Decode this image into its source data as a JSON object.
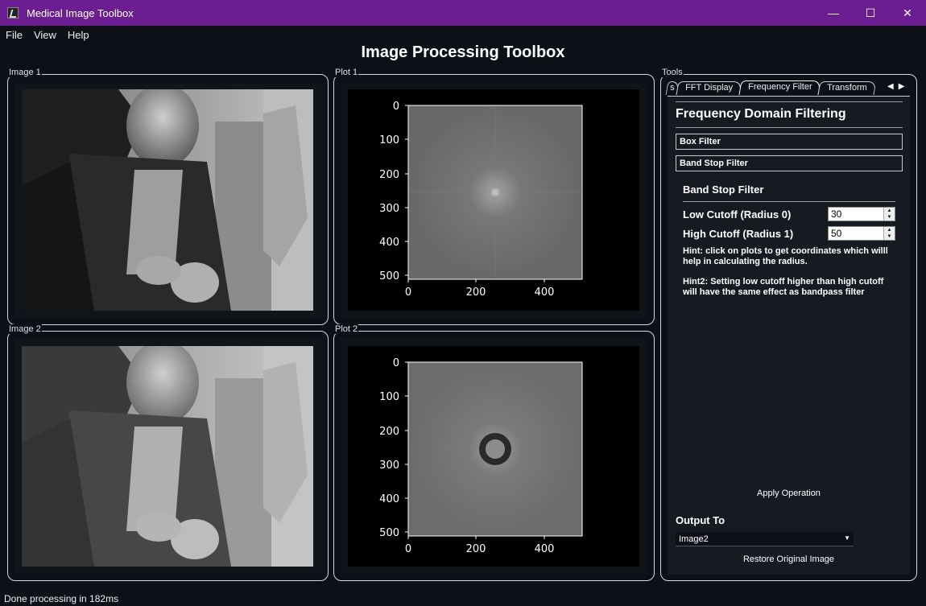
{
  "window": {
    "title": "Medical Image Toolbox",
    "min": "—",
    "max": "☐",
    "close": "✕"
  },
  "menu": [
    "File",
    "View",
    "Help"
  ],
  "heading": "Image Processing Toolbox",
  "groups": {
    "image1": "Image 1",
    "plot1": "Plot 1",
    "image2": "Image 2",
    "plot2": "Plot 2",
    "tools": "Tools"
  },
  "plot1": {
    "yticks": [
      "0",
      "100",
      "200",
      "300",
      "400",
      "500"
    ],
    "xticks": [
      "0",
      "200",
      "400"
    ]
  },
  "plot2": {
    "yticks": [
      "0",
      "100",
      "200",
      "300",
      "400",
      "500"
    ],
    "xticks": [
      "0",
      "200",
      "400"
    ]
  },
  "tabs": [
    "s",
    "FFT Display",
    "Frequency Filter",
    "Transform"
  ],
  "tools": {
    "title": "Frequency Domain Filtering",
    "box_filter": "Box Filter",
    "band_stop_filter": "Band Stop Filter",
    "section_title": "Band Stop Filter",
    "low_label": "Low Cutoff (Radius 0)",
    "low_value": "30",
    "high_label": "High Cutoff (Radius 1)",
    "high_value": "50",
    "hint1": "Hint: click on plots to get coordinates which willl help in calculating the radius.",
    "hint2": "Hint2: Setting low cutoff higher than high cutoff will have the same effect as bandpass filter",
    "apply": "Apply Operation",
    "output_label": "Output To",
    "output_value": "Image2",
    "restore": "Restore Original Image"
  },
  "status": "Done processing in 182ms"
}
